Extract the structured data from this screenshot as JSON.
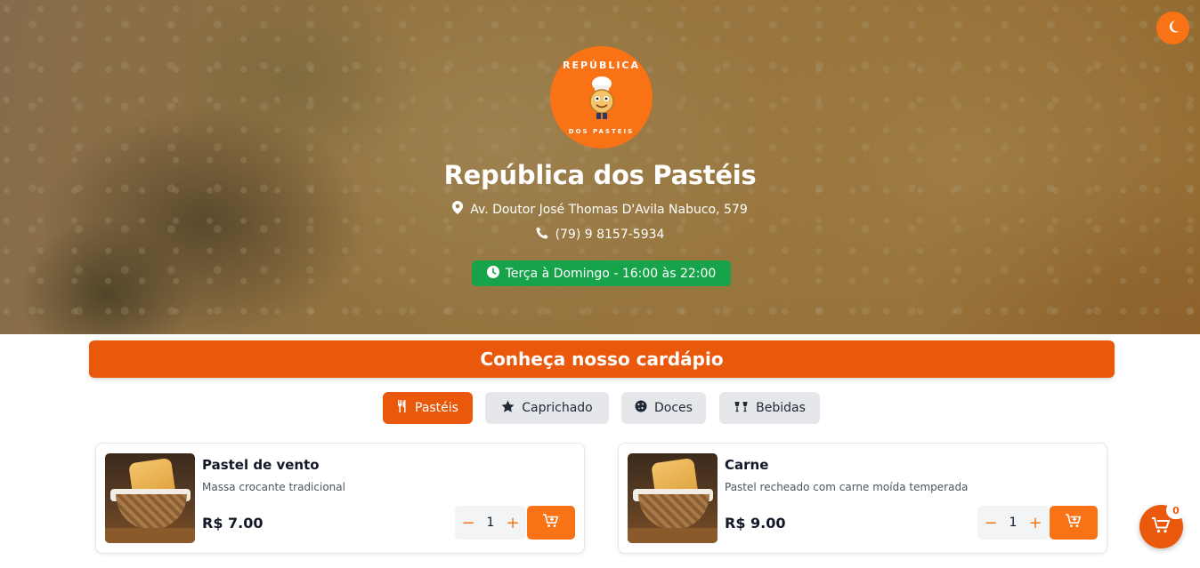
{
  "header": {
    "logo_top_text": "REPÚBLICA",
    "logo_bottom_text": "DOS PASTEIS",
    "restaurant_name": "República dos Pastéis",
    "address": "Av. Doutor José Thomas D'Avila Nabuco, 579",
    "phone": "(79) 9 8157-5934",
    "hours": "Terça à Domingo - 16:00 às 22:00",
    "theme_toggle_icon": "moon-icon"
  },
  "menu": {
    "banner_title": "Conheça nosso cardápio",
    "categories": [
      {
        "label": "Pastéis",
        "icon": "utensils-icon",
        "active": true
      },
      {
        "label": "Caprichado",
        "icon": "star-icon",
        "active": false
      },
      {
        "label": "Doces",
        "icon": "cookie-icon",
        "active": false
      },
      {
        "label": "Bebidas",
        "icon": "glasses-icon",
        "active": false
      }
    ],
    "items": [
      {
        "name": "Pastel de vento",
        "description": "Massa crocante tradicional",
        "price": "R$ 7.00",
        "quantity": "1"
      },
      {
        "name": "Carne",
        "description": "Pastel recheado com carne moída temperada",
        "price": "R$ 9.00",
        "quantity": "1"
      }
    ],
    "qty_minus": "−",
    "qty_plus": "+"
  },
  "cart": {
    "count": "0"
  },
  "colors": {
    "accent": "#ea580c",
    "accent_light": "#f97316",
    "success": "#16a34a"
  }
}
